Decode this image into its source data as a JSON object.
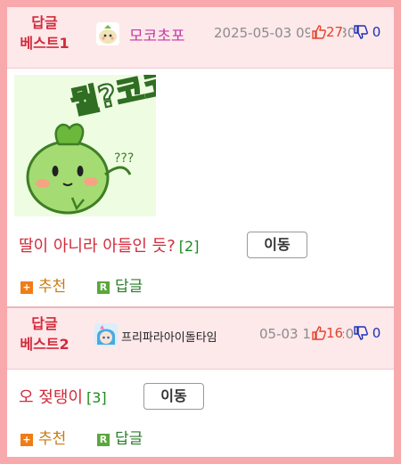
{
  "posts": [
    {
      "badge_line1": "답글",
      "badge_line2": "베스트1",
      "avatar_icon": "green-mascot-avatar-icon",
      "username": "모코초포",
      "datetime": "2025-05-03 09:52:30",
      "upvotes": "27",
      "downvotes": "0",
      "image_text": "뭘?코코",
      "title": "딸이 아니라 아들인 듯?",
      "comment_count": "[2]",
      "move_label": "이동",
      "recommend_label": "추천",
      "reply_label": "답글"
    },
    {
      "badge_line1": "답글",
      "badge_line2": "베스트2",
      "avatar_icon": "anime-character-avatar-icon",
      "username": "프리파라아이돌타임",
      "datetime": "05-03 11:31:05",
      "upvotes": "16",
      "downvotes": "0",
      "title": "오 젖탱이",
      "comment_count": "[3]",
      "move_label": "이동",
      "recommend_label": "추천",
      "reply_label": "답글"
    }
  ],
  "colors": {
    "frame": "#f7a9ab",
    "header_bg": "#fde8ea",
    "badge": "#d12b3c",
    "title": "#d12b3c",
    "comment_count": "#1f8a1f"
  }
}
